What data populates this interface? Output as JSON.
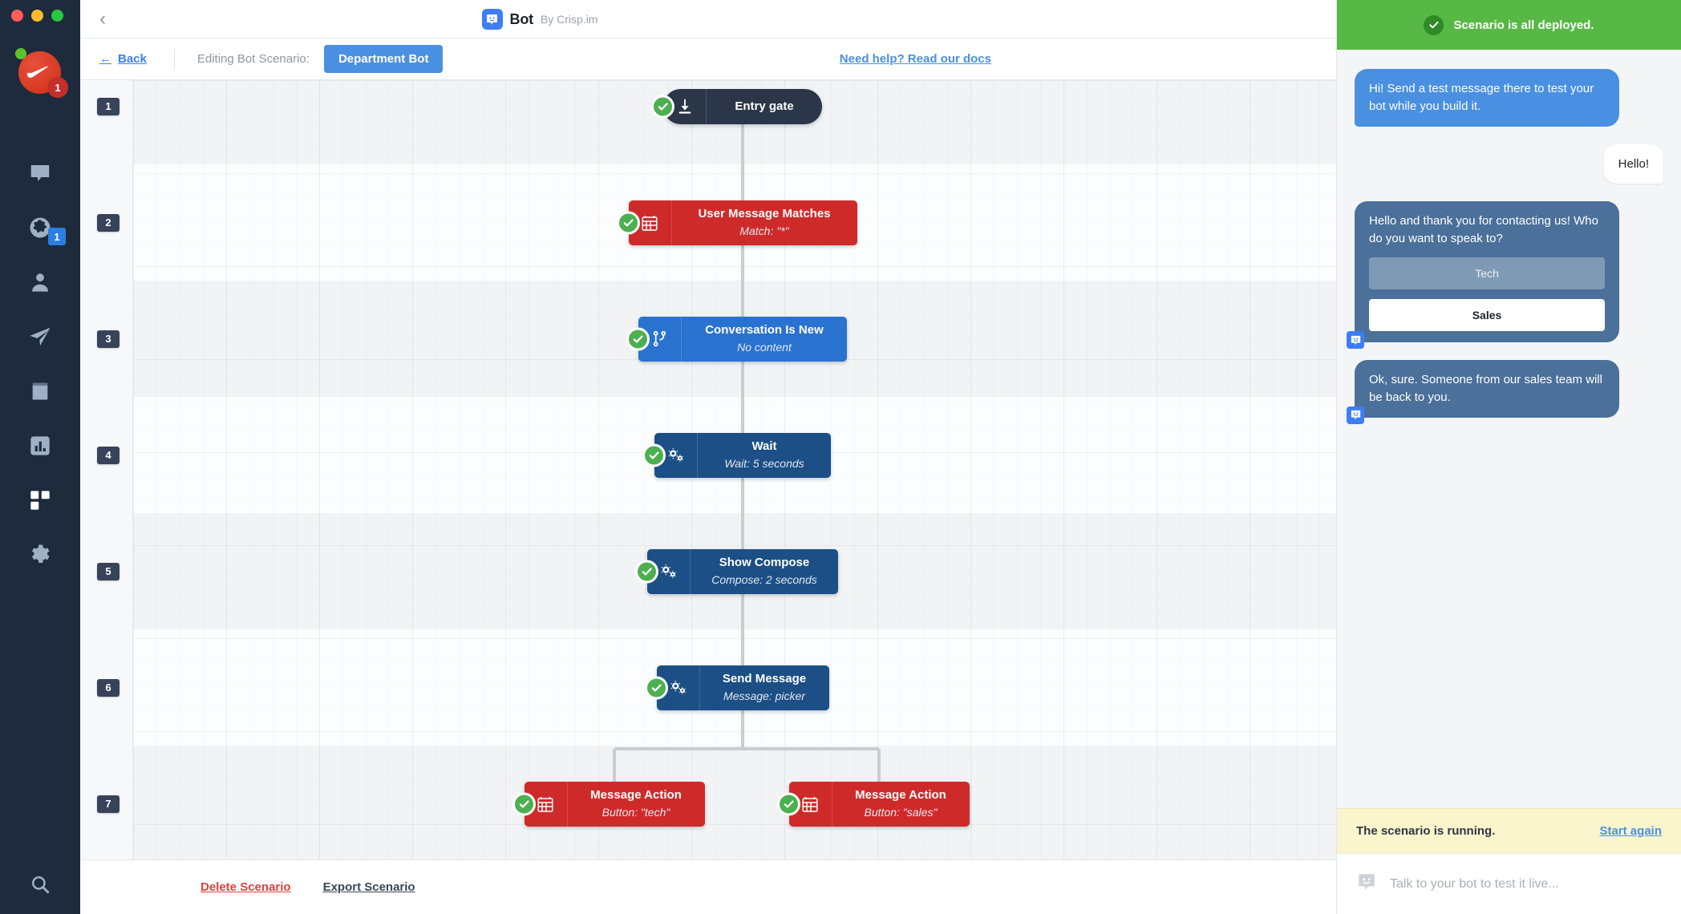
{
  "window": {
    "title": "Bot",
    "by": "By Crisp.im",
    "back_chevron_icon": "chevron-left-icon",
    "bot_logo_icon": "bot-face-icon"
  },
  "sidebar": {
    "avatar": {
      "name": "nike-avatar",
      "badge_count": "1",
      "online": true
    },
    "items": [
      {
        "icon": "chat-bubble-icon",
        "name": "sidebar-item-inbox",
        "badge": ""
      },
      {
        "icon": "globe-icon",
        "name": "sidebar-item-visitors",
        "badge": "1"
      },
      {
        "icon": "user-icon",
        "name": "sidebar-item-contacts",
        "badge": ""
      },
      {
        "icon": "paper-plane-icon",
        "name": "sidebar-item-campaigns",
        "badge": ""
      },
      {
        "icon": "book-icon",
        "name": "sidebar-item-helpdesk",
        "badge": ""
      },
      {
        "icon": "bar-chart-icon",
        "name": "sidebar-item-analytics",
        "badge": ""
      },
      {
        "icon": "grid-squares-icon",
        "name": "sidebar-item-plugins",
        "badge": ""
      },
      {
        "icon": "gear-icon",
        "name": "sidebar-item-settings",
        "badge": ""
      }
    ],
    "search_icon": "search-icon"
  },
  "subbar": {
    "back_label": "Back",
    "back_arrow": "←",
    "editing_label": "Editing Bot Scenario:",
    "scenario_name": "Department Bot",
    "docs_link": "Need help? Read our docs"
  },
  "canvas": {
    "row_numbers": [
      "1",
      "2",
      "3",
      "4",
      "5",
      "6",
      "7"
    ],
    "nodes": [
      {
        "row": "1",
        "title": "Entry gate",
        "subtitle": "",
        "color": "dark",
        "icon": "download-icon",
        "shape": "pill"
      },
      {
        "row": "2",
        "title": "User Message Matches",
        "subtitle": "Match: \"*\"",
        "color": "red",
        "icon": "calendar-icon",
        "shape": "rect"
      },
      {
        "row": "3",
        "title": "Conversation Is New",
        "subtitle": "No content",
        "color": "blue",
        "icon": "branch-icon",
        "shape": "rect"
      },
      {
        "row": "4",
        "title": "Wait",
        "subtitle": "Wait: 5 seconds",
        "color": "navy",
        "icon": "gears-icon",
        "shape": "rect"
      },
      {
        "row": "5",
        "title": "Show Compose",
        "subtitle": "Compose: 2 seconds",
        "color": "navy",
        "icon": "gears-icon",
        "shape": "rect"
      },
      {
        "row": "6",
        "title": "Send Message",
        "subtitle": "Message: picker",
        "color": "navy",
        "icon": "gears-icon",
        "shape": "rect"
      },
      {
        "row": "7",
        "title": "Message Action",
        "subtitle": "Button: \"tech\"",
        "color": "red",
        "icon": "calendar-icon",
        "shape": "rect"
      },
      {
        "row": "7",
        "title": "Message Action",
        "subtitle": "Button: \"sales\"",
        "color": "red",
        "icon": "calendar-icon",
        "shape": "rect"
      }
    ],
    "status_icon": "check-circle-icon"
  },
  "bottombar": {
    "delete_label": "Delete Scenario",
    "export_label": "Export Scenario"
  },
  "chat": {
    "deploy_status": "Scenario is all deployed.",
    "deploy_icon": "check-circle-icon",
    "messages": [
      {
        "kind": "blue",
        "text": "Hi! Send a test message there to test your bot while you build it."
      },
      {
        "kind": "white",
        "text": "Hello!"
      },
      {
        "kind": "slate",
        "text": "Hello and thank you for contacting us! Who do you want to speak to?",
        "buttons": [
          "Tech",
          "Sales"
        ],
        "selected": "Sales",
        "bot_tag_icon": "bot-face-icon"
      },
      {
        "kind": "slate",
        "text": "Ok, sure. Someone from our sales team will be back to you.",
        "bot_tag_icon": "bot-face-icon"
      }
    ],
    "running_text": "The scenario is running.",
    "start_again": "Start again",
    "compose_placeholder": "Talk to your bot to test it live...",
    "compose_icon": "bot-face-icon"
  },
  "colors": {
    "sidebar_bg": "#1e2b3c",
    "accent_blue": "#4a90e2",
    "node_red": "#cf2a2a",
    "node_blue": "#2a72cf",
    "node_navy": "#1c4f85",
    "node_dark": "#2b3648",
    "deploy_green": "#58b845",
    "running_yellow": "#fbf5cd",
    "delete_red": "#e0413c"
  }
}
